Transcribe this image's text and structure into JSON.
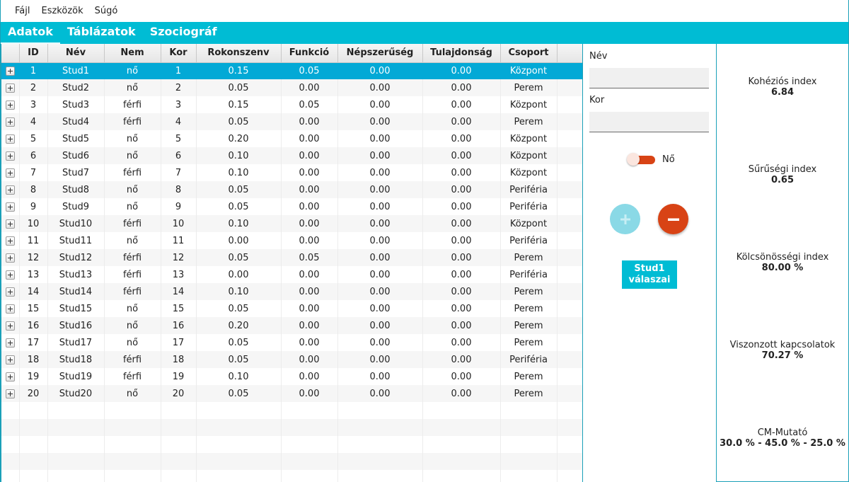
{
  "menu": [
    "Fájl",
    "Eszközök",
    "Súgó"
  ],
  "tabs": [
    "Adatok",
    "Táblázatok",
    "Szociográf"
  ],
  "table": {
    "headers": [
      "ID",
      "Név",
      "Nem",
      "Kor",
      "Rokonszenv",
      "Funkció",
      "Népszerűség",
      "Tulajdonság",
      "Csoport"
    ],
    "rows": [
      [
        "1",
        "Stud1",
        "nő",
        "1",
        "0.15",
        "0.05",
        "0.00",
        "0.00",
        "Központ"
      ],
      [
        "2",
        "Stud2",
        "nő",
        "2",
        "0.05",
        "0.00",
        "0.00",
        "0.00",
        "Perem"
      ],
      [
        "3",
        "Stud3",
        "férfi",
        "3",
        "0.15",
        "0.05",
        "0.00",
        "0.00",
        "Központ"
      ],
      [
        "4",
        "Stud4",
        "férfi",
        "4",
        "0.05",
        "0.00",
        "0.00",
        "0.00",
        "Perem"
      ],
      [
        "5",
        "Stud5",
        "nő",
        "5",
        "0.20",
        "0.00",
        "0.00",
        "0.00",
        "Központ"
      ],
      [
        "6",
        "Stud6",
        "nő",
        "6",
        "0.10",
        "0.00",
        "0.00",
        "0.00",
        "Központ"
      ],
      [
        "7",
        "Stud7",
        "férfi",
        "7",
        "0.10",
        "0.00",
        "0.00",
        "0.00",
        "Központ"
      ],
      [
        "8",
        "Stud8",
        "nő",
        "8",
        "0.05",
        "0.00",
        "0.00",
        "0.00",
        "Periféria"
      ],
      [
        "9",
        "Stud9",
        "nő",
        "9",
        "0.05",
        "0.00",
        "0.00",
        "0.00",
        "Periféria"
      ],
      [
        "10",
        "Stud10",
        "férfi",
        "10",
        "0.10",
        "0.00",
        "0.00",
        "0.00",
        "Központ"
      ],
      [
        "11",
        "Stud11",
        "nő",
        "11",
        "0.00",
        "0.00",
        "0.00",
        "0.00",
        "Periféria"
      ],
      [
        "12",
        "Stud12",
        "férfi",
        "12",
        "0.05",
        "0.05",
        "0.00",
        "0.00",
        "Perem"
      ],
      [
        "13",
        "Stud13",
        "férfi",
        "13",
        "0.00",
        "0.00",
        "0.00",
        "0.00",
        "Periféria"
      ],
      [
        "14",
        "Stud14",
        "férfi",
        "14",
        "0.10",
        "0.00",
        "0.00",
        "0.00",
        "Perem"
      ],
      [
        "15",
        "Stud15",
        "nő",
        "15",
        "0.05",
        "0.00",
        "0.00",
        "0.00",
        "Perem"
      ],
      [
        "16",
        "Stud16",
        "nő",
        "16",
        "0.20",
        "0.00",
        "0.00",
        "0.00",
        "Perem"
      ],
      [
        "17",
        "Stud17",
        "nő",
        "17",
        "0.05",
        "0.00",
        "0.00",
        "0.00",
        "Perem"
      ],
      [
        "18",
        "Stud18",
        "férfi",
        "18",
        "0.05",
        "0.00",
        "0.00",
        "0.00",
        "Periféria"
      ],
      [
        "19",
        "Stud19",
        "férfi",
        "19",
        "0.10",
        "0.00",
        "0.00",
        "0.00",
        "Perem"
      ],
      [
        "20",
        "Stud20",
        "nő",
        "20",
        "0.05",
        "0.00",
        "0.00",
        "0.00",
        "Perem"
      ]
    ],
    "selected_row": 0
  },
  "form": {
    "name_label": "Név",
    "name_value": "",
    "age_label": "Kor",
    "age_value": "",
    "toggle_label": "Nő",
    "toggle_on": true,
    "answers_button": "Stud1 válaszai"
  },
  "stats": [
    {
      "label": "Kohéziós index",
      "value": "6.84"
    },
    {
      "label": "Sűrűségi index",
      "value": "0.65"
    },
    {
      "label": "Kölcsönösségi index",
      "value": "80.00 %"
    },
    {
      "label": "Viszonzott kapcsolatok",
      "value": "70.27 %"
    },
    {
      "label": "CM-Mutató",
      "value": "30.0 % - 45.0 % - 25.0 %"
    }
  ],
  "colors": {
    "accent": "#00bcd4",
    "selection": "#03a9d6",
    "danger": "#d84315"
  }
}
